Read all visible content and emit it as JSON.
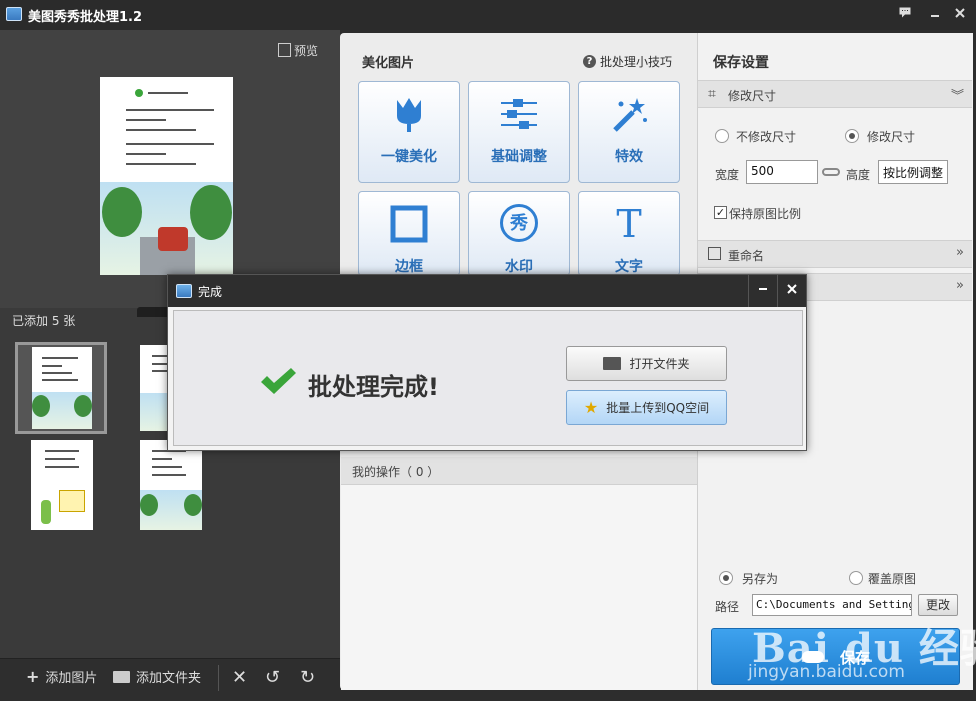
{
  "window": {
    "title": "美图秀秀批处理1.2"
  },
  "left": {
    "preview_label": "预览",
    "added_count": "已添加 5 张",
    "bottom": {
      "add_image": "添加图片",
      "add_folder": "添加文件夹"
    }
  },
  "middle": {
    "beautify_title": "美化图片",
    "tips": "批处理小技巧",
    "tools": [
      {
        "label": "一键美化",
        "icon": "tulip-icon"
      },
      {
        "label": "基础调整",
        "icon": "sliders-icon"
      },
      {
        "label": "特效",
        "icon": "magic-wand-icon"
      },
      {
        "label": "边框",
        "icon": "frame-icon"
      },
      {
        "label": "水印",
        "icon": "watermark-icon",
        "glyph": "秀"
      },
      {
        "label": "文字",
        "icon": "text-icon",
        "glyph": "T"
      }
    ],
    "ops_label": "我的操作（ 0 ）"
  },
  "right": {
    "title": "保存设置",
    "resize": {
      "header": "修改尺寸",
      "option_no": "不修改尺寸",
      "option_yes": "修改尺寸",
      "selected": "option_yes",
      "width_label": "宽度",
      "width_value": "500",
      "height_label": "高度",
      "height_value": "按比例调整",
      "keep_ratio": "保持原图比例",
      "keep_ratio_checked": true
    },
    "rename_header": "重命名",
    "save_as": "另存为",
    "overwrite": "覆盖原图",
    "save_mode": "save_as",
    "path_label": "路径",
    "path_value": "C:\\Documents and Settings\\",
    "change_btn": "更改",
    "save_btn": "保存",
    "watermark": "Bai du 经验",
    "watermark_url": "jingyan.baidu.com"
  },
  "dialog": {
    "title": "完成",
    "message": "批处理完成!",
    "open_folder": "打开文件夹",
    "upload": "批量上传到QQ空间",
    "accent": "#3aa53a"
  }
}
